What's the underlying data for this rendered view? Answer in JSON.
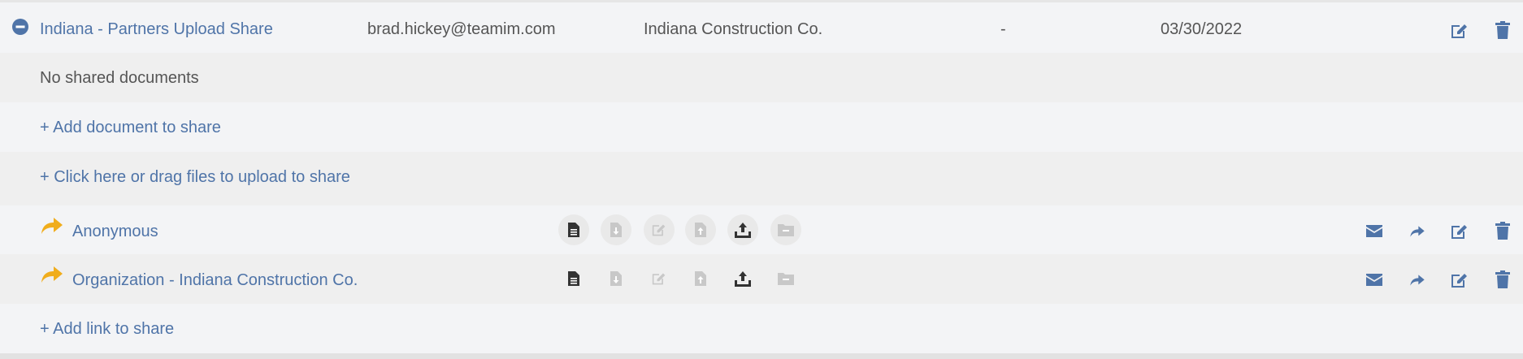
{
  "share": {
    "name": "Indiana - Partners Upload Share",
    "owner_email": "brad.hickey@teamim.com",
    "organization": "Indiana Construction Co.",
    "expires": "-",
    "date": "03/30/2022"
  },
  "documents": {
    "empty_text": "No shared documents",
    "add_document_label": "+ Add document to share",
    "upload_label": "+ Click here or drag files to upload to share"
  },
  "links": [
    {
      "name": "Anonymous",
      "permissions": {
        "view": true,
        "download": false,
        "edit": false,
        "upload_version": false,
        "upload": true,
        "folder": false
      }
    },
    {
      "name": "Organization - Indiana Construction Co.",
      "permissions": {
        "view": true,
        "download": false,
        "edit": false,
        "upload_version": false,
        "upload": true,
        "folder": false
      }
    }
  ],
  "add_link_label": "+ Add link to share",
  "colors": {
    "link_blue": "#4f74a8",
    "share_arrow_orange": "#f0ad1c",
    "icon_dark": "#333333",
    "icon_disabled": "#c8c8c8"
  }
}
